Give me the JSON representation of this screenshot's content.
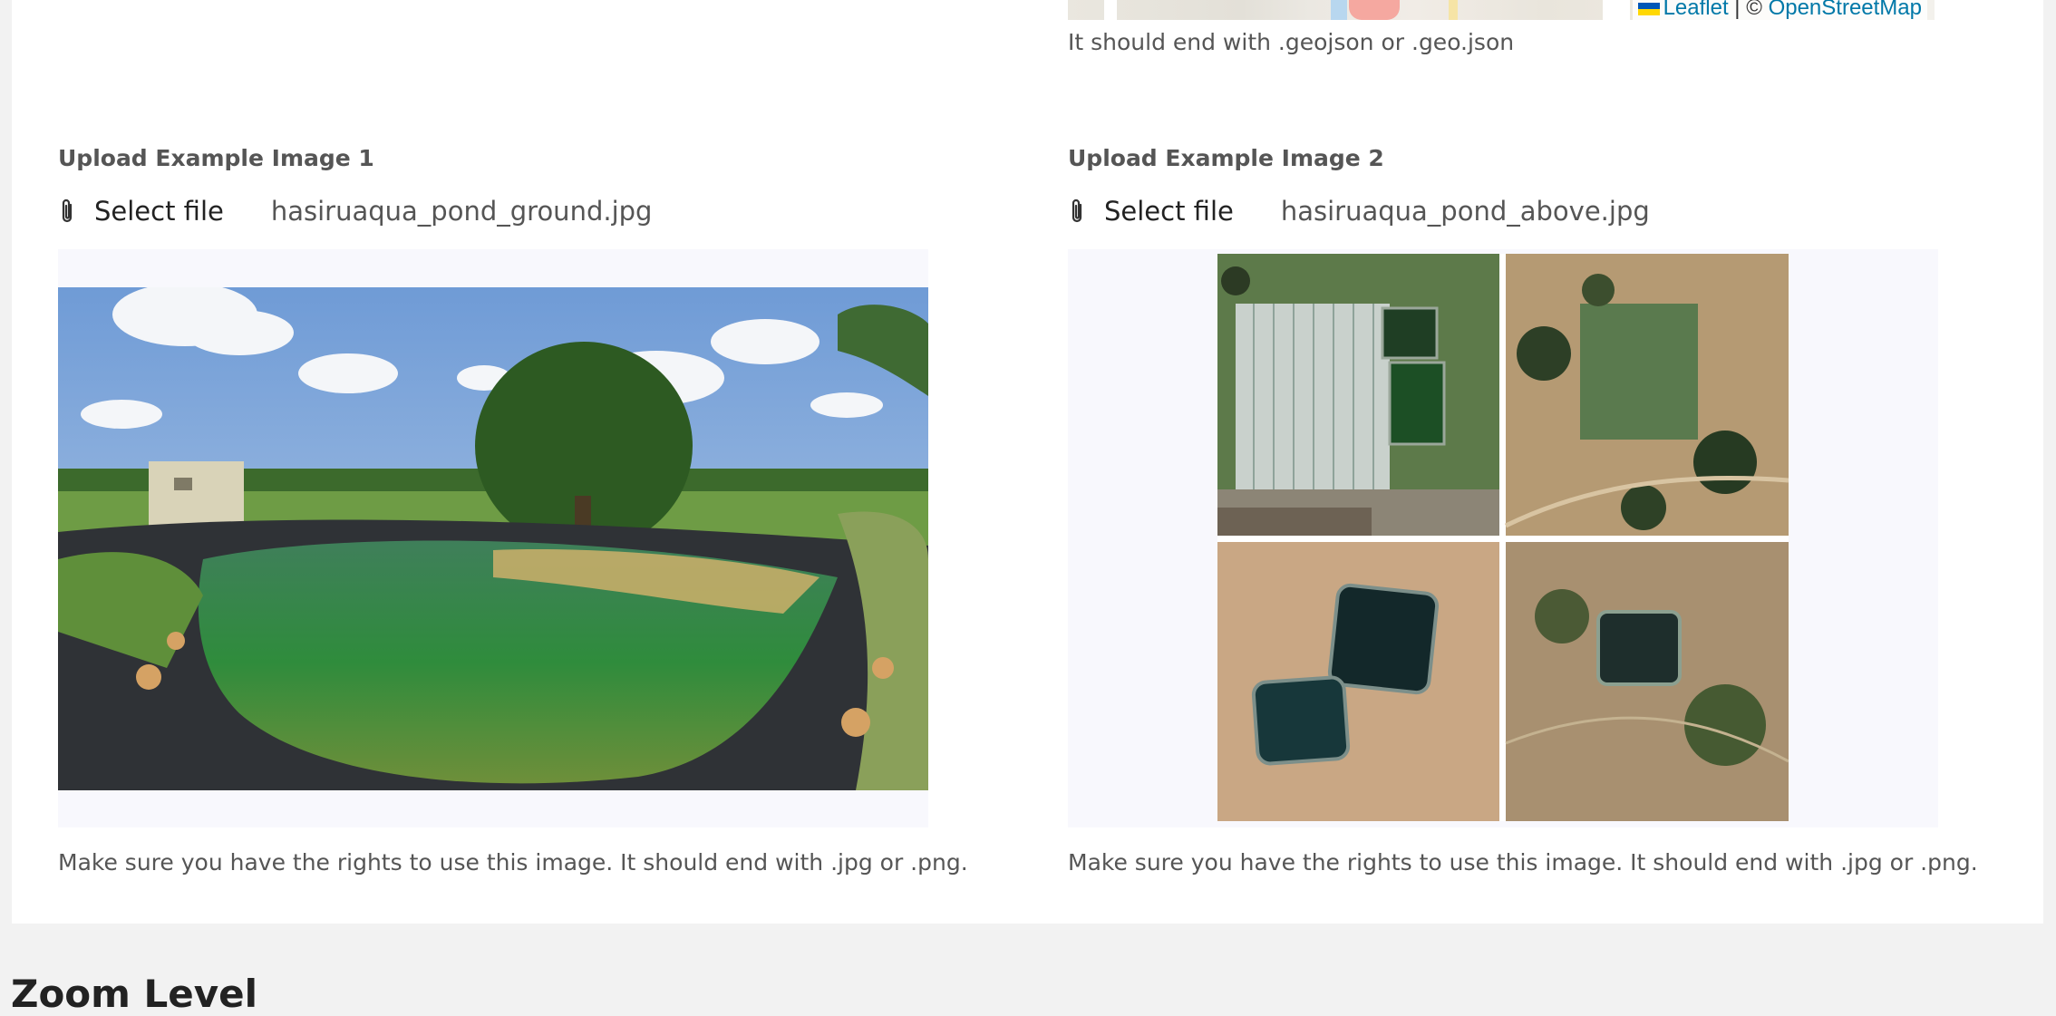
{
  "map": {
    "attribution_leaflet": "Leaflet",
    "attribution_separator": "| ©",
    "attribution_osm": "OpenStreetMap",
    "hint": "It should end with .geojson or .geo.json"
  },
  "upload1": {
    "label": "Upload Example Image 1",
    "select_label": "Select file",
    "filename": "hasiruaqua_pond_ground.jpg",
    "hint": "Make sure you have the rights to use this image. It should end with .jpg or .png."
  },
  "upload2": {
    "label": "Upload Example Image 2",
    "select_label": "Select file",
    "filename": "hasiruaqua_pond_above.jpg",
    "hint": "Make sure you have the rights to use this image. It should end with .jpg or .png."
  },
  "next_section": {
    "title": "Zoom Level"
  },
  "icons": {
    "attach": "paperclip-icon",
    "flag": "ukraine-flag-icon"
  }
}
